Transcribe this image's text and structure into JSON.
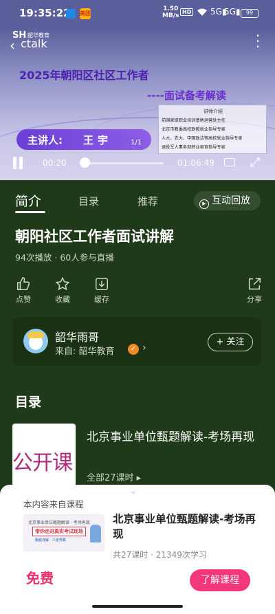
{
  "status_bar": {
    "time": "19:35:22",
    "app_badge": "美团",
    "speed_value": "1.50",
    "speed_unit": "MB/s",
    "hd": "HD",
    "signal1": "5G",
    "signal2": "5G",
    "battery": "99"
  },
  "video": {
    "logo_brand": "韶华教育",
    "logo_mark": "SH",
    "logo_sub": "ctalk",
    "title": "2025年朝阳区社区工作者",
    "subtitle": "----面试备考解读",
    "speaker_label": "主讲人:",
    "speaker_name": "王宇",
    "intro_title": "讲师介绍",
    "intro_lines": [
      "前国家级职业培训基地运营处主任",
      "北京市教委高校联盟就业指导专家",
      "人大、农大、中国政法等高校就业指导专家",
      "退役军人事务部转业君官指导专家"
    ],
    "page_indicator": "1/1",
    "current_time": "00:20",
    "duration": "01:06:49",
    "progress": 0.005
  },
  "tabs": [
    {
      "label": "简介",
      "active": true
    },
    {
      "label": "目录",
      "active": false
    },
    {
      "label": "推荐",
      "active": false
    }
  ],
  "replay_label": "互动回放",
  "course": {
    "title": "朝阳社区工作者面试讲解",
    "meta": "94次播放 · 60人参与直播"
  },
  "actions": {
    "like": "点赞",
    "favorite": "收藏",
    "cache": "缓存",
    "share": "分享"
  },
  "author": {
    "name": "韶华雨哥",
    "source": "来自: 韶华教育",
    "badge": "✓",
    "follow": "+ 关注"
  },
  "toc": {
    "heading": "目录",
    "thumb_text": "公开课",
    "title": "北京事业单位甄题解读-考场再现",
    "count": "全部27课时 ▸"
  },
  "sheet": {
    "from_label": "本内容来自课程",
    "thumb_line1": "北京事业单位甄题解读 · 考场再现",
    "thumb_line2": "带你走进真实考试现场",
    "thumb_line3": "甄题详解 · 少走弯路",
    "title": "北京事业单位甄题解读-考场再现",
    "meta": "共27课时 · 21349次学习",
    "price": "免费",
    "button": "了解课程"
  },
  "colors": {
    "background": "#1f3a18",
    "accent": "#f4377a",
    "price": "#f0306a",
    "badge": "#f08a24"
  }
}
